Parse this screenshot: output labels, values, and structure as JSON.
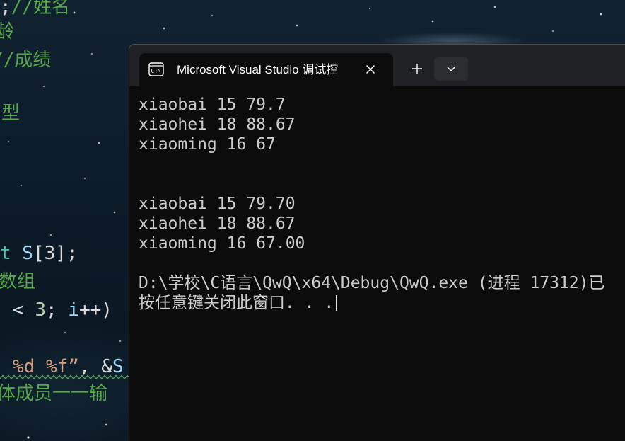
{
  "editor": {
    "lines": [
      {
        "segments": [
          {
            "text": ";"
          },
          {
            "text": "//姓名"
          }
        ]
      },
      {
        "segments": [
          {
            "text": "龄"
          }
        ]
      },
      {
        "segments": [
          {
            "text": "//成绩"
          }
        ]
      },
      {
        "segments": [
          {
            "text": "型"
          }
        ]
      },
      {
        "segments": [
          {
            "text": "t"
          },
          {
            "text": " S"
          },
          {
            "text": "[3];"
          }
        ]
      },
      {
        "segments": [
          {
            "text": "数组"
          }
        ]
      },
      {
        "segments": [
          {
            "text": "< "
          },
          {
            "text": "3"
          },
          {
            "text": "; "
          },
          {
            "text": "i"
          },
          {
            "text": "++)"
          }
        ]
      },
      {
        "segments": [
          {
            "text": "%d %f”"
          },
          {
            "text": ", &"
          },
          {
            "text": "S"
          }
        ]
      },
      {
        "segments": [
          {
            "text": "体成员一一输"
          }
        ]
      }
    ]
  },
  "terminal": {
    "tab": {
      "icon": "terminal-icon",
      "icon_glyph": "C:\\",
      "title": "Microsoft Visual Studio 调试控",
      "close_icon": "close-icon"
    },
    "new_tab_icon": "plus-icon",
    "dropdown_icon": "chevron-down-icon",
    "output_lines": [
      "xiaobai 15 79.7",
      "xiaohei 18 88.67",
      "xiaoming 16 67",
      "",
      "",
      "xiaobai 15 79.70",
      "xiaohei 18 88.67",
      "xiaoming 16 67.00",
      "",
      "D:\\学校\\C语言\\QwQ\\x64\\Debug\\QwQ.exe (进程 17312)已",
      "按任意键关闭此窗口. . ."
    ]
  },
  "colors": {
    "plain": "#dcdcdc",
    "comment": "#57a64a",
    "type": "#4ec9b0",
    "identifier": "#9cdcfe",
    "number": "#b5cea8",
    "string": "#d69d85",
    "squiggle": "#5fa95a",
    "console_text": "#cccccc"
  }
}
